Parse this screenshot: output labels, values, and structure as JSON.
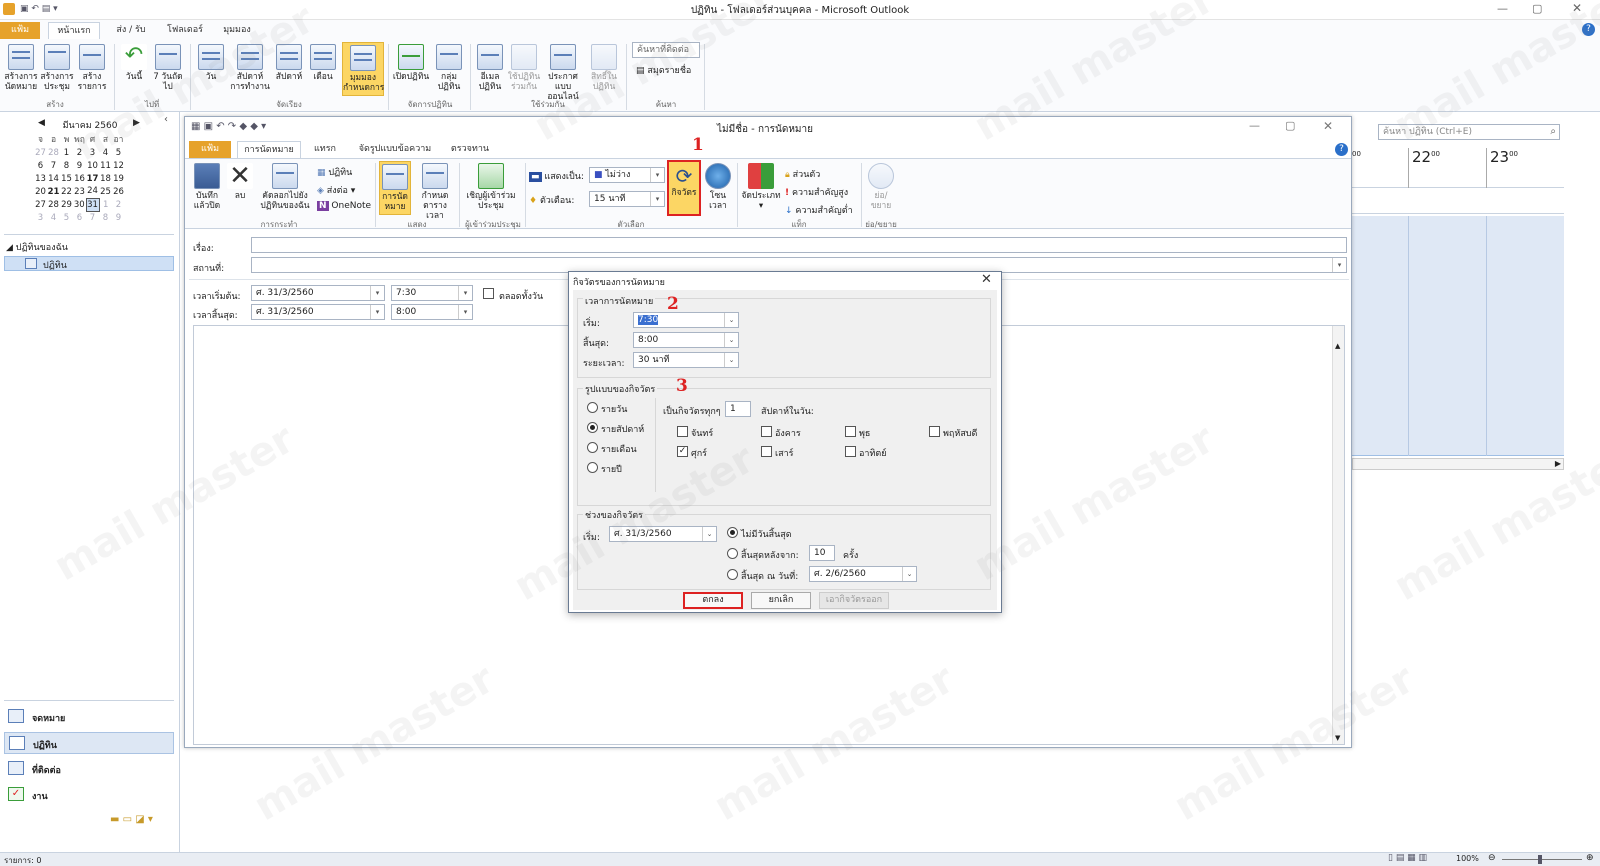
{
  "window": {
    "title": "ปฏิทิน - โฟลเดอร์ส่วนบุคคล - Microsoft Outlook"
  },
  "ribbon": {
    "tabs": [
      "แฟ้ม",
      "หน้าแรก",
      "ส่ง / รับ",
      "โฟลเดอร์",
      "มุมมอง"
    ],
    "buttons": {
      "new_appt": "สร้างการนัดหมาย",
      "new_meeting": "สร้างการประชุม",
      "new_items": "สร้างรายการ",
      "today": "วันนี้",
      "next7": "7 วันถัดไป",
      "day": "วัน",
      "workweek": "สัปดาห์การทำงาน",
      "week": "สัปดาห์",
      "month": "เดือน",
      "schedule": "มุมมองกำหนดการ",
      "open_cal": "เปิดปฏิทิน",
      "cal_groups": "กลุ่มปฏิทิน",
      "email_cal": "อีเมลปฏิทิน",
      "share_cal": "ใช้ปฏิทินร่วมกัน",
      "publish": "ประกาศแบบออนไลน์",
      "cal_perm": "สิทธิ์ในปฏิทิน",
      "find_contact": "ค้นหาที่ติดต่อ",
      "addr_book": "สมุดรายชื่อ"
    },
    "groups": [
      "สร้าง",
      "ไปที่",
      "จัดเรียง",
      "จัดการปฏิทิน",
      "ใช้ร่วมกัน",
      "ค้นหา"
    ]
  },
  "sidebar": {
    "month_label": "มีนาคม 2560",
    "weekdays": [
      "จ",
      "อ",
      "พ",
      "พฤ",
      "ศ",
      "ส",
      "อา"
    ],
    "weeks": [
      [
        "27",
        "28",
        "1",
        "2",
        "3",
        "4",
        "5"
      ],
      [
        "6",
        "7",
        "8",
        "9",
        "10",
        "11",
        "12"
      ],
      [
        "13",
        "14",
        "15",
        "16",
        "17",
        "18",
        "19"
      ],
      [
        "20",
        "21",
        "22",
        "23",
        "24",
        "25",
        "26"
      ],
      [
        "27",
        "28",
        "29",
        "30",
        "31",
        "1",
        "2"
      ],
      [
        "3",
        "4",
        "5",
        "6",
        "7",
        "8",
        "9"
      ]
    ],
    "my_calendars": "ปฏิทินของฉัน",
    "calendar_item": "ปฏิทิน",
    "nav": [
      "จดหมาย",
      "ปฏิทิน",
      "ที่ติดต่อ",
      "งาน"
    ]
  },
  "right": {
    "search_placeholder": "ค้นหา ปฏิทิน (Ctrl+E)",
    "hour_22": "22",
    "hour_23": "23",
    "min_00": "00"
  },
  "appt": {
    "title": "ไม่มีชื่อ - การนัดหมาย",
    "tabs": [
      "แฟ้ม",
      "การนัดหมาย",
      "แทรก",
      "จัดรูปแบบข้อความ",
      "ตรวจทาน"
    ],
    "buttons": {
      "save_close": "บันทึกแล้วปิด",
      "delete": "ลบ",
      "copy_to": "คัดลอกไปยังปฏิทินของฉัน",
      "calendar": "ปฏิทิน",
      "forward": "ส่งต่อ",
      "onenote": "OneNote",
      "appointment": "การนัดหมาย",
      "scheduling": "กำหนดตารางเวลา",
      "invite": "เชิญผู้เข้าร่วมประชุม",
      "show_as_label": "แสดงเป็น:",
      "show_as_value": "ไม่ว่าง",
      "reminder_label": "ตัวเตือน:",
      "reminder_value": "15 นาที",
      "recurrence": "กิจวัตร",
      "timezones": "โซนเวลา",
      "categorize": "จัดประเภท",
      "private": "ส่วนตัว",
      "high": "ความสำคัญสูง",
      "low": "ความสำคัญต่ำ",
      "zoom": "ย่อ/ขยาย"
    },
    "groups": [
      "การกระทำ",
      "แสดง",
      "ผู้เข้าร่วมประชุม",
      "ตัวเลือก",
      "แท็ก",
      "ย่อ/ขยาย"
    ],
    "subject_label": "เรื่อง:",
    "location_label": "สถานที่:",
    "start_label": "เวลาเริ่มต้น:",
    "end_label": "เวลาสิ้นสุด:",
    "start_date": "ศ. 31/3/2560",
    "start_time": "7:30",
    "end_date": "ศ. 31/3/2560",
    "end_time": "8:00",
    "allday_label": "ตลอดทั้งวัน"
  },
  "dialog": {
    "title": "กิจวัตรของการนัดหมาย",
    "sec_time": "เวลาการนัดหมาย",
    "start_label": "เริ่ม:",
    "start_value": "7:30",
    "end_label": "สิ้นสุด:",
    "end_value": "8:00",
    "duration_label": "ระยะเวลา:",
    "duration_value": "30 นาที",
    "sec_pattern": "รูปแบบของกิจวัตร",
    "patterns": [
      "รายวัน",
      "รายสัปดาห์",
      "รายเดือน",
      "รายปี"
    ],
    "recur_every": "เป็นกิจวัตรทุกๆ",
    "recur_value": "1",
    "weeks_on": "สัปดาห์ในวัน:",
    "days": [
      "จันทร์",
      "อังคาร",
      "พุธ",
      "พฤหัสบดี",
      "ศุกร์",
      "เสาร์",
      "อาทิตย์"
    ],
    "sec_range": "ช่วงของกิจวัตร",
    "range_start_label": "เริ่ม:",
    "range_start_value": "ศ. 31/3/2560",
    "no_end": "ไม่มีวันสิ้นสุด",
    "end_after": "สิ้นสุดหลังจาก:",
    "end_after_value": "10",
    "occurrences": "ครั้ง",
    "end_by": "สิ้นสุด ณ วันที่:",
    "end_by_value": "ศ. 2/6/2560",
    "ok": "ตกลง",
    "cancel": "ยกเลิก",
    "remove": "เอากิจวัตรออก"
  },
  "markers": [
    "1",
    "2",
    "3"
  ],
  "watermark": "mail master",
  "status": {
    "items": "รายการ: 0",
    "zoom": "100%"
  },
  "colors": {
    "accent": "#e6a22b",
    "highlight": "#fcd664",
    "marker": "#dd2222",
    "calendar_blue": "#dfe8f5"
  }
}
